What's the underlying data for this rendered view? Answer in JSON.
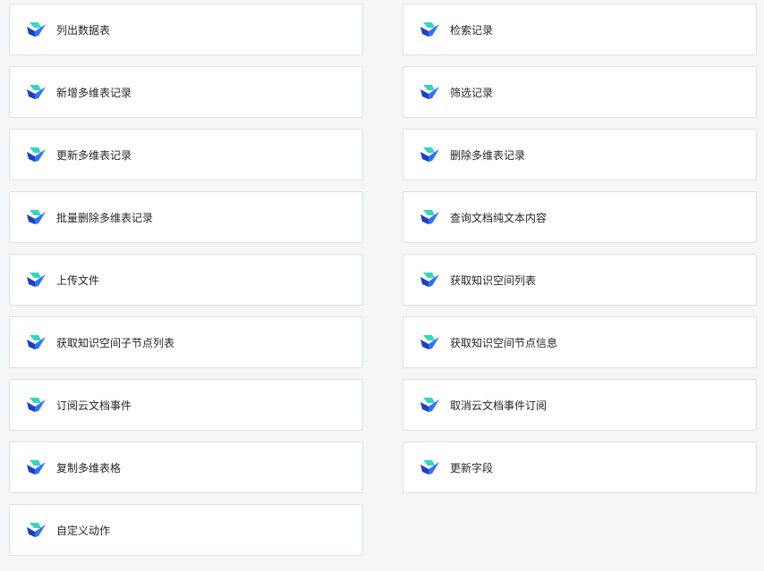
{
  "actions": [
    {
      "label": "列出数据表",
      "name": "action-card-list-tables"
    },
    {
      "label": "检索记录",
      "name": "action-card-search-records"
    },
    {
      "label": "新增多维表记录",
      "name": "action-card-add-bitable-record"
    },
    {
      "label": "筛选记录",
      "name": "action-card-filter-records"
    },
    {
      "label": "更新多维表记录",
      "name": "action-card-update-bitable-record"
    },
    {
      "label": "删除多维表记录",
      "name": "action-card-delete-bitable-record"
    },
    {
      "label": "批量删除多维表记录",
      "name": "action-card-batch-delete-bitable-records"
    },
    {
      "label": "查询文档纯文本内容",
      "name": "action-card-query-doc-plain-text"
    },
    {
      "label": "上传文件",
      "name": "action-card-upload-file"
    },
    {
      "label": "获取知识空间列表",
      "name": "action-card-get-wiki-space-list"
    },
    {
      "label": "获取知识空间子节点列表",
      "name": "action-card-get-wiki-child-node-list"
    },
    {
      "label": "获取知识空间节点信息",
      "name": "action-card-get-wiki-node-info"
    },
    {
      "label": "订阅云文档事件",
      "name": "action-card-subscribe-doc-events"
    },
    {
      "label": "取消云文档事件订阅",
      "name": "action-card-unsubscribe-doc-events"
    },
    {
      "label": "复制多维表格",
      "name": "action-card-copy-bitable"
    },
    {
      "label": "更新字段",
      "name": "action-card-update-field"
    },
    {
      "label": "自定义动作",
      "name": "action-card-custom-action"
    }
  ],
  "icon": {
    "name": "lark-logo-icon",
    "colors": {
      "teal": "#33d6c0",
      "blue": "#3370ff",
      "navy": "#1e3fbf"
    }
  }
}
